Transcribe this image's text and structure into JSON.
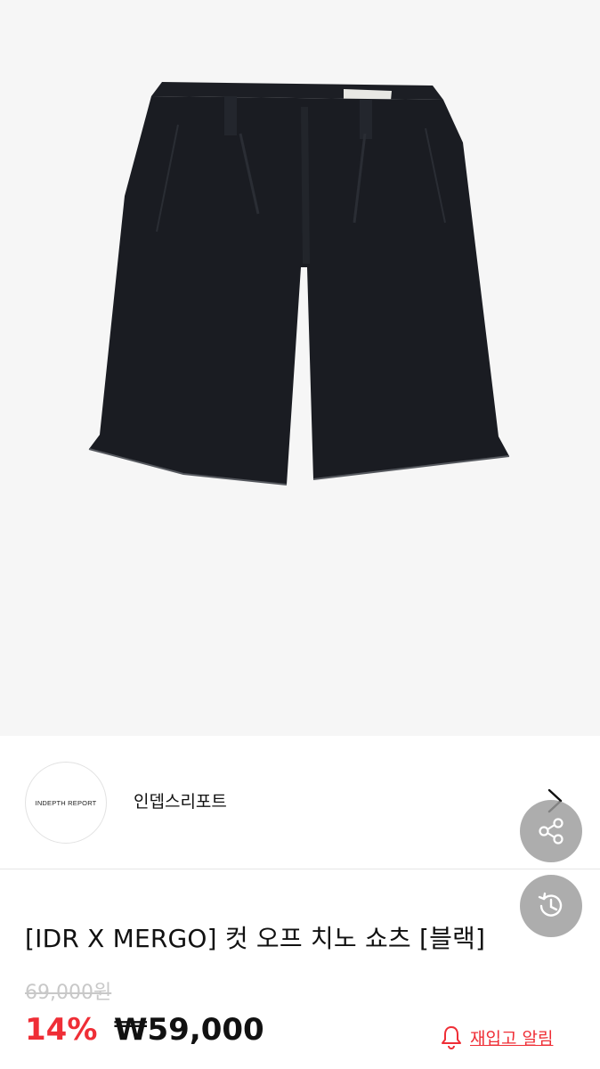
{
  "brand": {
    "logo_text": "INDEPTH REPORT",
    "name": "인뎁스리포트"
  },
  "product": {
    "title": "[IDR X MERGO] 컷 오프 치노 쇼츠 [블랙]",
    "original_price": "69,000원",
    "discount": "14%",
    "sale_price": "₩59,000"
  },
  "actions": {
    "restock_label": "재입고 알림"
  },
  "colors": {
    "accent_red": "#ef2e36",
    "image_bg": "#f6f6f6",
    "fab_gray": "#9b9b9b"
  },
  "icons": [
    "chevron-right-icon",
    "share-icon",
    "history-icon",
    "bell-icon"
  ]
}
